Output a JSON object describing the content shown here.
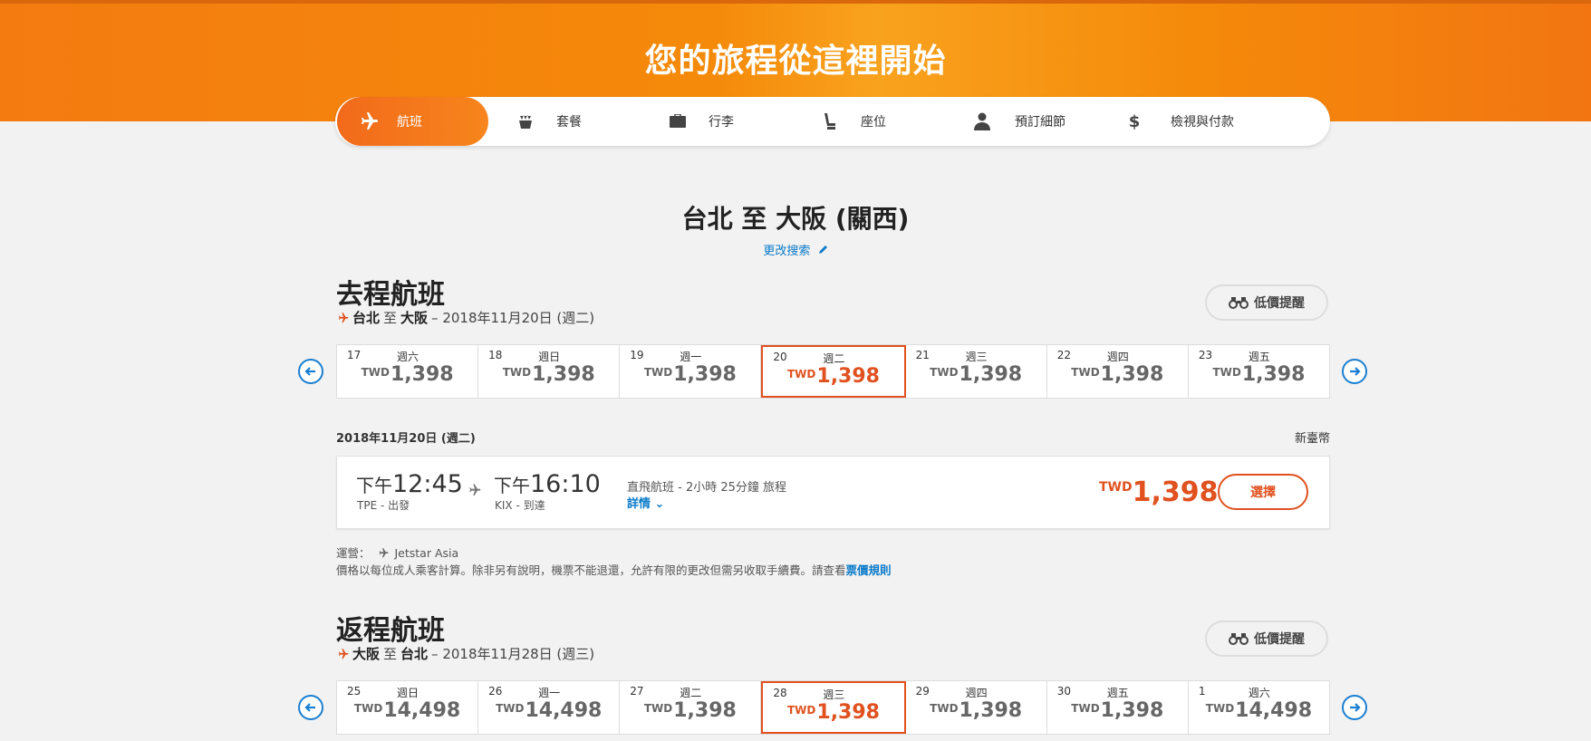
{
  "header": {
    "title": "您的旅程從這裡開始"
  },
  "steps": [
    {
      "label": "航班",
      "icon": "plane-icon"
    },
    {
      "label": "套餐",
      "icon": "meal-icon"
    },
    {
      "label": "行李",
      "icon": "luggage-icon"
    },
    {
      "label": "座位",
      "icon": "seat-icon"
    },
    {
      "label": "預訂細節",
      "icon": "person-icon"
    },
    {
      "label": "檢視與付款",
      "icon": "dollar-icon"
    }
  ],
  "route": {
    "title": "台北 至 大阪 (關西)",
    "modify_label": "更改搜索"
  },
  "outbound": {
    "title": "去程航班",
    "from": "台北",
    "to_word": "至",
    "to": "大阪",
    "date_text": "– 2018年11月20日 (週二)",
    "alert_label": "低價提醒",
    "days": [
      {
        "num": "17",
        "weekday": "週六",
        "cur": "TWD",
        "price": "1,398",
        "selected": false
      },
      {
        "num": "18",
        "weekday": "週日",
        "cur": "TWD",
        "price": "1,398",
        "selected": false
      },
      {
        "num": "19",
        "weekday": "週一",
        "cur": "TWD",
        "price": "1,398",
        "selected": false
      },
      {
        "num": "20",
        "weekday": "週二",
        "cur": "TWD",
        "price": "1,398",
        "selected": true
      },
      {
        "num": "21",
        "weekday": "週三",
        "cur": "TWD",
        "price": "1,398",
        "selected": false
      },
      {
        "num": "22",
        "weekday": "週四",
        "cur": "TWD",
        "price": "1,398",
        "selected": false
      },
      {
        "num": "23",
        "weekday": "週五",
        "cur": "TWD",
        "price": "1,398",
        "selected": false
      }
    ]
  },
  "flight": {
    "date_label": "2018年11月20日 (週二)",
    "currency_label": "新臺幣",
    "depart_prefix": "下午",
    "depart_time": "12:45",
    "depart_sub": "TPE - 出發",
    "arrive_prefix": "下午",
    "arrive_time": "16:10",
    "arrive_sub": "KIX - 到達",
    "info": "直飛航班 - 2小時 25分鐘 旅程",
    "details_label": "詳情",
    "price_cur": "TWD",
    "price": "1,398",
    "select_label": "選擇"
  },
  "notes": {
    "operated_label": "運營：",
    "operator": "Jetstar Asia",
    "fare_text": "價格以每位成人乘客計算。除非另有說明，機票不能退還，允許有限的更改但需另收取手續費。請查看",
    "fare_link": "票價規則"
  },
  "inbound": {
    "title": "返程航班",
    "from": "大阪",
    "to_word": "至",
    "to": "台北",
    "date_text": "– 2018年11月28日 (週三)",
    "alert_label": "低價提醒",
    "days": [
      {
        "num": "25",
        "weekday": "週日",
        "cur": "TWD",
        "price": "14,498",
        "selected": false
      },
      {
        "num": "26",
        "weekday": "週一",
        "cur": "TWD",
        "price": "14,498",
        "selected": false
      },
      {
        "num": "27",
        "weekday": "週二",
        "cur": "TWD",
        "price": "1,398",
        "selected": false
      },
      {
        "num": "28",
        "weekday": "週三",
        "cur": "TWD",
        "price": "1,398",
        "selected": true
      },
      {
        "num": "29",
        "weekday": "週四",
        "cur": "TWD",
        "price": "1,398",
        "selected": false
      },
      {
        "num": "30",
        "weekday": "週五",
        "cur": "TWD",
        "price": "1,398",
        "selected": false
      },
      {
        "num": "1",
        "weekday": "週六",
        "cur": "TWD",
        "price": "14,498",
        "selected": false
      }
    ]
  },
  "colors": {
    "accent": "#e0511f",
    "brand_orange": "#f58a0a",
    "link": "#0a7ac9"
  }
}
